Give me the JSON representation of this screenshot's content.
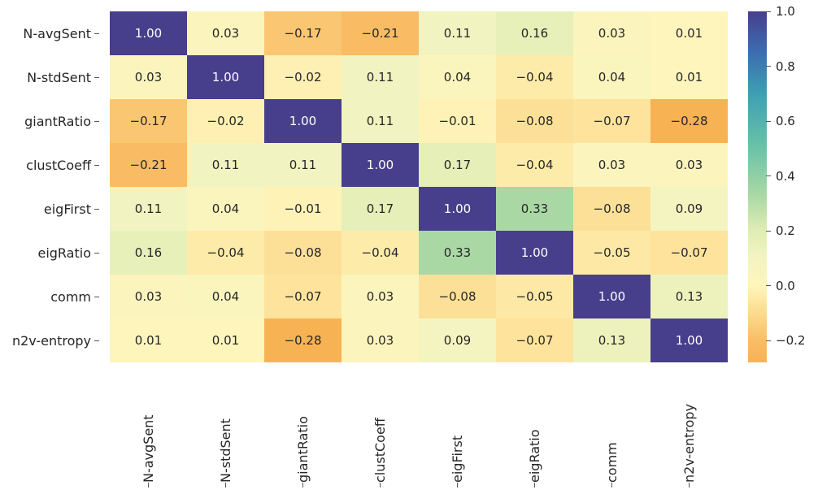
{
  "chart_data": {
    "type": "heatmap",
    "labels": [
      "N-avgSent",
      "N-stdSent",
      "giantRatio",
      "clustCoeff",
      "eigFirst",
      "eigRatio",
      "comm",
      "n2v-entropy"
    ],
    "matrix": [
      [
        1.0,
        0.03,
        -0.17,
        -0.21,
        0.11,
        0.16,
        0.03,
        0.01
      ],
      [
        0.03,
        1.0,
        -0.02,
        0.11,
        0.04,
        -0.04,
        0.04,
        0.01
      ],
      [
        -0.17,
        -0.02,
        1.0,
        0.11,
        -0.01,
        -0.08,
        -0.07,
        -0.28
      ],
      [
        -0.21,
        0.11,
        0.11,
        1.0,
        0.17,
        -0.04,
        0.03,
        0.03
      ],
      [
        0.11,
        0.04,
        -0.01,
        0.17,
        1.0,
        0.33,
        -0.08,
        0.09
      ],
      [
        0.16,
        -0.04,
        -0.08,
        -0.04,
        0.33,
        1.0,
        -0.05,
        -0.07
      ],
      [
        0.03,
        0.04,
        -0.07,
        0.03,
        -0.08,
        -0.05,
        1.0,
        0.13
      ],
      [
        0.01,
        0.01,
        -0.28,
        0.03,
        0.09,
        -0.07,
        0.13,
        1.0
      ]
    ],
    "colorbar": {
      "vmin": -0.28,
      "vmax": 1.0,
      "ticks": [
        -0.2,
        0.0,
        0.2,
        0.4,
        0.6,
        0.8,
        1.0
      ],
      "tick_labels": [
        "−0.2",
        "0.0",
        "0.2",
        "0.4",
        "0.6",
        "0.8",
        "1.0"
      ],
      "colormap": "viridis-like",
      "stops": [
        {
          "v": -0.28,
          "c": "#f7b254"
        },
        {
          "v": -0.2,
          "c": "#f9bd66"
        },
        {
          "v": -0.1,
          "c": "#fcdb8f"
        },
        {
          "v": 0.0,
          "c": "#fef5bb"
        },
        {
          "v": 0.1,
          "c": "#f3f4c1"
        },
        {
          "v": 0.2,
          "c": "#dfedb3"
        },
        {
          "v": 0.33,
          "c": "#a9d8a5"
        },
        {
          "v": 0.5,
          "c": "#6bc3a8"
        },
        {
          "v": 0.7,
          "c": "#3e9fb3"
        },
        {
          "v": 0.85,
          "c": "#3b6db0"
        },
        {
          "v": 1.0,
          "c": "#483f8c"
        }
      ]
    }
  }
}
